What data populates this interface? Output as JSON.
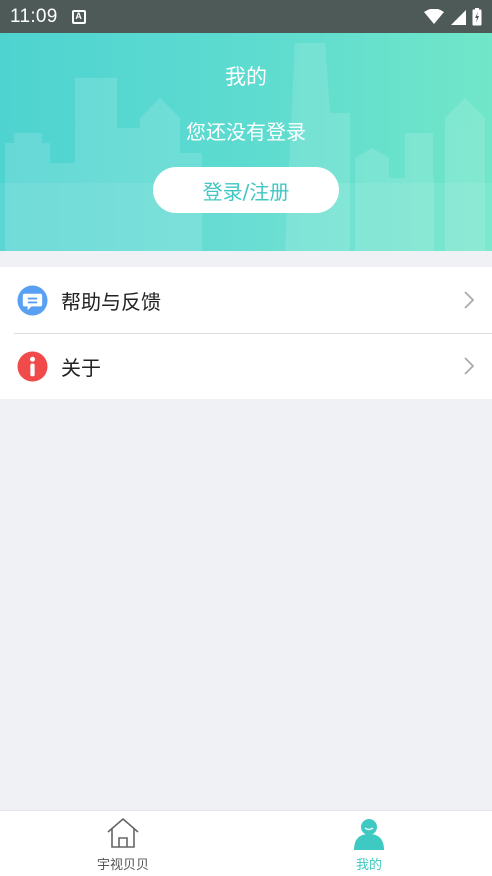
{
  "status_bar": {
    "time": "11:09",
    "notification_icon": "A"
  },
  "header": {
    "title": "我的",
    "subtitle": "您还没有登录",
    "login_button": "登录/注册",
    "gradient_start": "#4fd3d0",
    "gradient_end": "#71e6c9"
  },
  "menu": {
    "items": [
      {
        "label": "帮助与反馈",
        "icon": "chat-bubble-icon",
        "icon_color": "#5aa0f2"
      },
      {
        "label": "关于",
        "icon": "info-icon",
        "icon_color": "#f04a4a"
      }
    ]
  },
  "bottom_nav": {
    "tabs": [
      {
        "label": "宇视贝贝",
        "icon": "home-icon",
        "active": false
      },
      {
        "label": "我的",
        "icon": "user-icon",
        "active": true
      }
    ],
    "active_color": "#3ec9c2"
  }
}
